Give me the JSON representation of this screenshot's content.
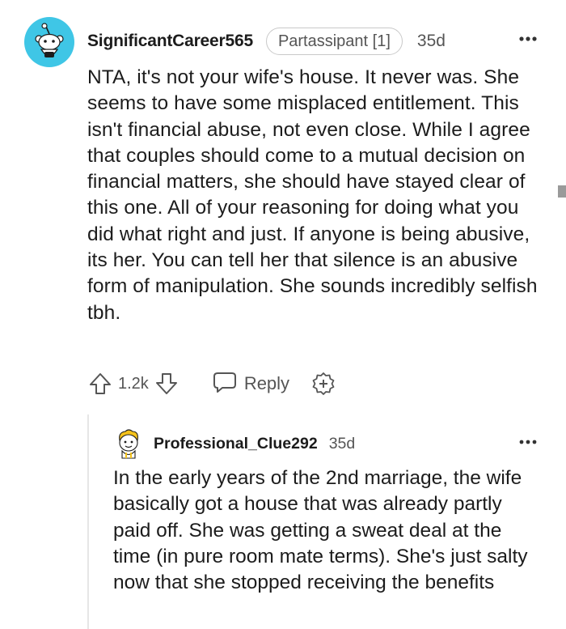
{
  "comment": {
    "username": "SignificantCareer565",
    "flair": "Partassipant [1]",
    "time": "35d",
    "body": "NTA, it's not your wife's house. It never was. She seems to have some misplaced entitlement. This isn't financial abuse, not even close. While I agree that couples should come to a mutual decision on financial matters, she should have stayed clear of this one. All of your reasoning for doing what you did what right and just. If anyone is being abusive, its her. You can tell her that silence is an abusive form of manipulation. She sounds incredibly selfish tbh.",
    "vote_count": "1.2k",
    "reply_label": "Reply",
    "avatar_icon": "snoo-avatar-icon",
    "colors": {
      "avatar_bg": "#3fc6e6"
    }
  },
  "reply": {
    "username": "Professional_Clue292",
    "time": "35d",
    "body": "In the early years of the 2nd marriage, the wife basically got a house that was already partly paid off. She was getting a sweat deal at the time (in pure room mate terms). She's just salty now that she stopped receiving the benefits",
    "avatar_icon": "cartoon-avatar-icon"
  },
  "icons": {
    "upvote": "upvote-arrow-icon",
    "downvote": "downvote-arrow-icon",
    "reply": "speech-bubble-icon",
    "award": "award-plus-icon",
    "more": "more-dots-icon"
  },
  "colors": {
    "text": "#1c1c1c",
    "meta": "#555555",
    "thread_line": "#e6e6e6"
  }
}
